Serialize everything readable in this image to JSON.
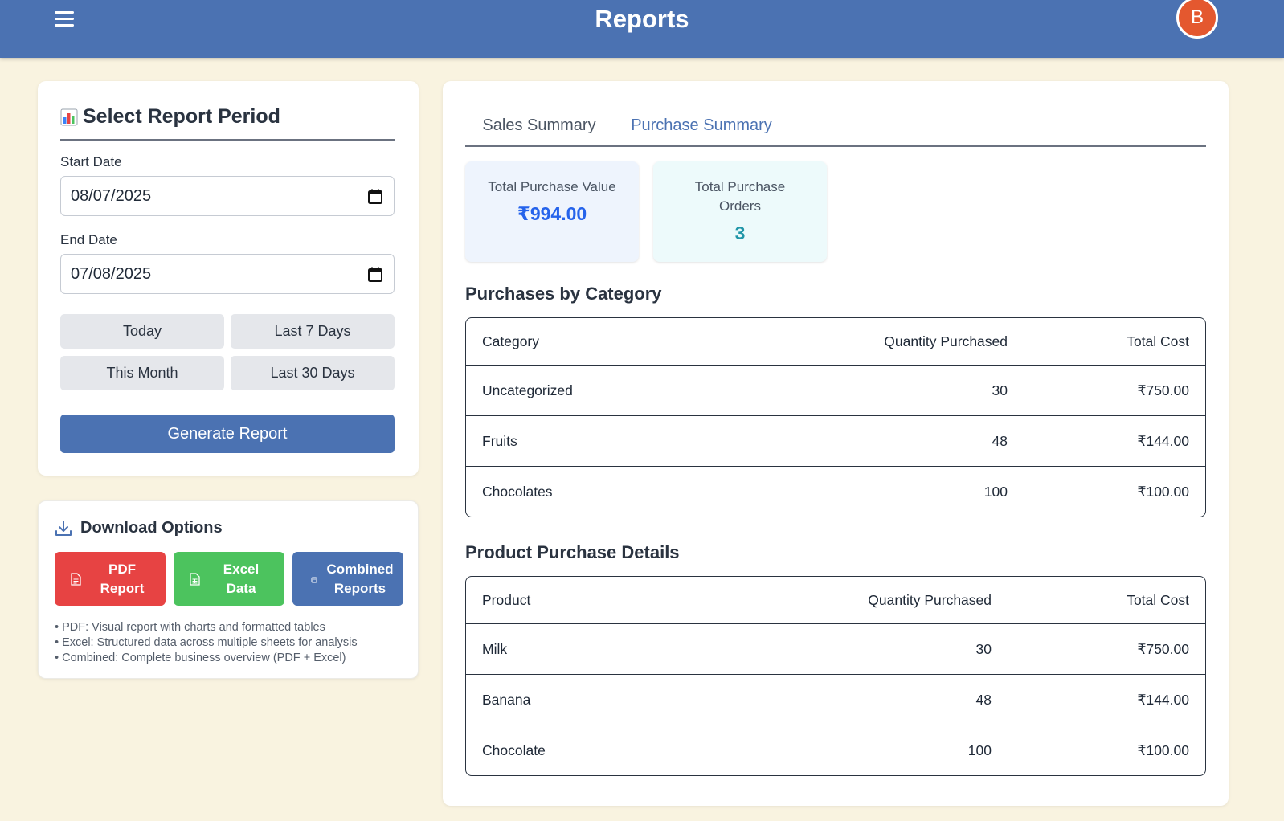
{
  "header": {
    "title": "Reports",
    "avatar_initial": "B",
    "menu_icon": "hamburger-menu-icon"
  },
  "period": {
    "title": "Select Report Period",
    "title_icon": "bar-chart-icon",
    "start_label": "Start Date",
    "start_value": "08/07/2025",
    "end_label": "End Date",
    "end_value": "07/08/2025",
    "quick_ranges": [
      "Today",
      "Last 7 Days",
      "This Month",
      "Last 30 Days"
    ],
    "generate_label": "Generate Report"
  },
  "download": {
    "title": "Download Options",
    "title_icon": "download-icon",
    "buttons": [
      {
        "line1": "PDF",
        "line2": "Report",
        "color": "#e74343"
      },
      {
        "line1": "Excel",
        "line2": "Data",
        "color": "#4cc35e"
      },
      {
        "line1": "Combined",
        "line2": "Reports",
        "color": "#4b72b2"
      }
    ],
    "notes": [
      "• PDF: Visual report with charts and formatted tables",
      "• Excel: Structured data across multiple sheets for analysis",
      "• Combined: Complete business overview (PDF + Excel)"
    ]
  },
  "tabs": [
    "Sales Summary",
    "Purchase Summary"
  ],
  "active_tab": "Purchase Summary",
  "stats": {
    "total_value_label": "Total Purchase Value",
    "total_value": "₹994.00",
    "total_orders_label_1": "Total Purchase",
    "total_orders_label_2": "Orders",
    "total_orders": "3"
  },
  "category_table": {
    "title": "Purchases by Category",
    "headers": [
      "Category",
      "Quantity Purchased",
      "Total Cost"
    ],
    "rows": [
      [
        "Uncategorized",
        "30",
        "₹750.00"
      ],
      [
        "Fruits",
        "48",
        "₹144.00"
      ],
      [
        "Chocolates",
        "100",
        "₹100.00"
      ]
    ]
  },
  "product_table": {
    "title": "Product Purchase Details",
    "headers": [
      "Product",
      "Quantity Purchased",
      "Total Cost"
    ],
    "rows": [
      [
        "Milk",
        "30",
        "₹750.00"
      ],
      [
        "Banana",
        "48",
        "₹144.00"
      ],
      [
        "Chocolate",
        "100",
        "₹100.00"
      ]
    ]
  },
  "colors": {
    "primary": "#4b72b2",
    "background": "#f9f3e0",
    "avatar": "#e4582f",
    "value_blue": "#2563eb",
    "orders_teal": "#2196a8"
  }
}
